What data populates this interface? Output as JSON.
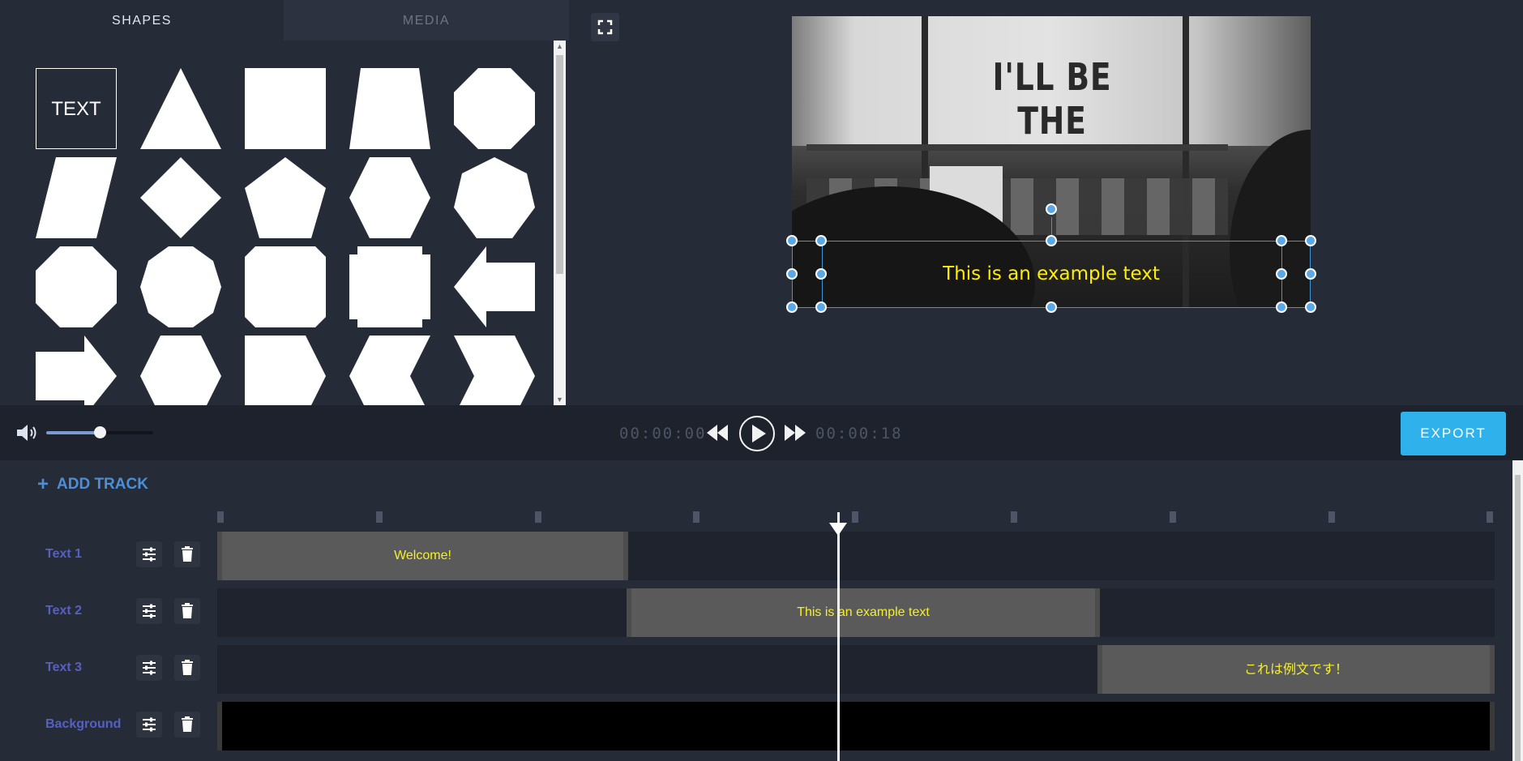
{
  "tabs": {
    "shapes": "SHAPES",
    "media": "MEDIA"
  },
  "shapes": [
    {
      "name": "text-shape",
      "label": "TEXT"
    },
    {
      "name": "triangle-shape"
    },
    {
      "name": "square-shape"
    },
    {
      "name": "trapezoid-shape"
    },
    {
      "name": "octagon-shape"
    },
    {
      "name": "parallelogram-shape"
    },
    {
      "name": "diamond-shape"
    },
    {
      "name": "pentagon-shape"
    },
    {
      "name": "hexagon-shape"
    },
    {
      "name": "heptagon-shape"
    },
    {
      "name": "octagon-2-shape"
    },
    {
      "name": "decagon-shape"
    },
    {
      "name": "dodecagon-shape"
    },
    {
      "name": "cross-shape"
    },
    {
      "name": "arrow-left-shape"
    },
    {
      "name": "arrow-right-shape"
    },
    {
      "name": "hexagon-2-shape"
    },
    {
      "name": "point-right-shape"
    },
    {
      "name": "chevron-left-shape"
    },
    {
      "name": "chevron-right-shape"
    }
  ],
  "preview": {
    "sign_text": "I'LL BE THE",
    "caption": "This is an example text",
    "caption_color": "#ffee00"
  },
  "controls": {
    "volume_icon": "volume-icon",
    "volume_level": 0.5,
    "time_current": "00:00:00",
    "time_total": "00:00:18",
    "export_label": "EXPORT",
    "export_color": "#2fb2ec"
  },
  "timeline": {
    "add_track_label": "ADD TRACK",
    "tracks": [
      {
        "name": "Text 1",
        "clip": "Welcome!"
      },
      {
        "name": "Text 2",
        "clip": "This is an example text"
      },
      {
        "name": "Text 3",
        "clip": "これは例文です！"
      },
      {
        "name": "Background",
        "clip": ""
      }
    ],
    "clip_text_color": "#f5ef2b",
    "track_name_color": "#5560c4"
  }
}
